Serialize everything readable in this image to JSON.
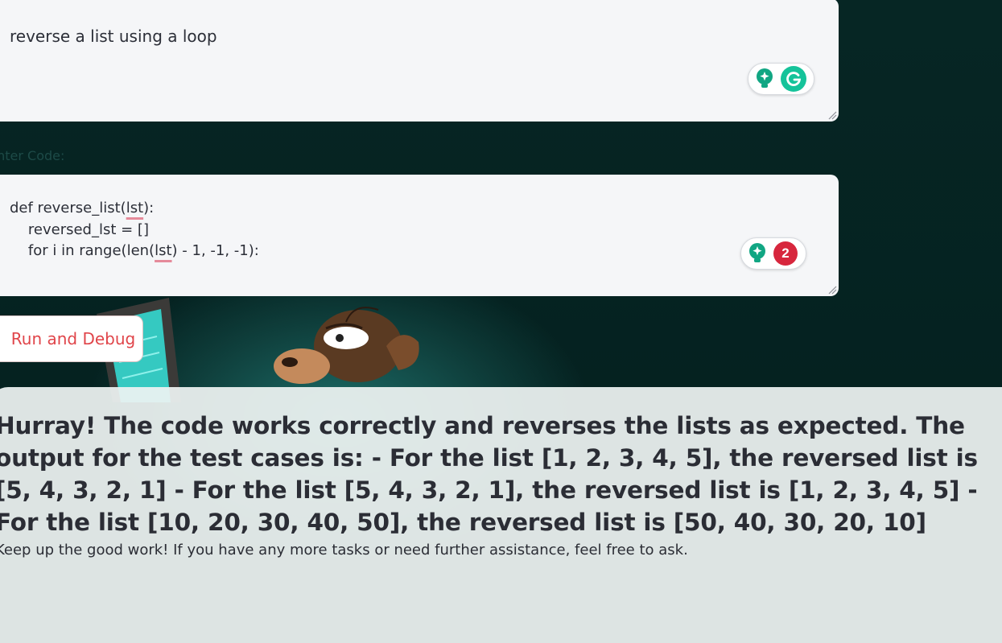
{
  "prompt": {
    "value": "reverse a list using a loop"
  },
  "code_section": {
    "label": "Enter Code:",
    "lines": [
      {
        "before": "def reverse_list(",
        "flag": "lst",
        "after": "):"
      },
      {
        "text": "    reversed_lst = []"
      },
      {
        "before": "    for i in range(len(",
        "flag": "lst",
        "after": ") - 1, -1, -1):"
      }
    ]
  },
  "grammarly": {
    "prompt_widget": {
      "icons": [
        "lightbulb-icon",
        "grammarly-logo-icon"
      ]
    },
    "code_widget": {
      "issue_count": "2"
    }
  },
  "actions": {
    "run_label": "Run and Debug"
  },
  "result": {
    "heading": "Hurray! The code works correctly and reverses the lists as expected. The output for the test cases is: - For the list [1, 2, 3, 4, 5], the reversed list is [5, 4, 3, 2, 1] - For the list [5, 4, 3, 2, 1], the reversed list is [1, 2, 3, 4, 5] - For the list [10, 20, 30, 40, 50], the reversed list is [50, 40, 30, 20, 10]",
    "note": "Keep up the good work! If you have any more tasks or need further assistance, feel free to ask."
  },
  "colors": {
    "page_background": "#062624",
    "run_button_text": "#e0454a",
    "grammarly_green": "#15c39a",
    "issue_badge": "#d7263d"
  }
}
